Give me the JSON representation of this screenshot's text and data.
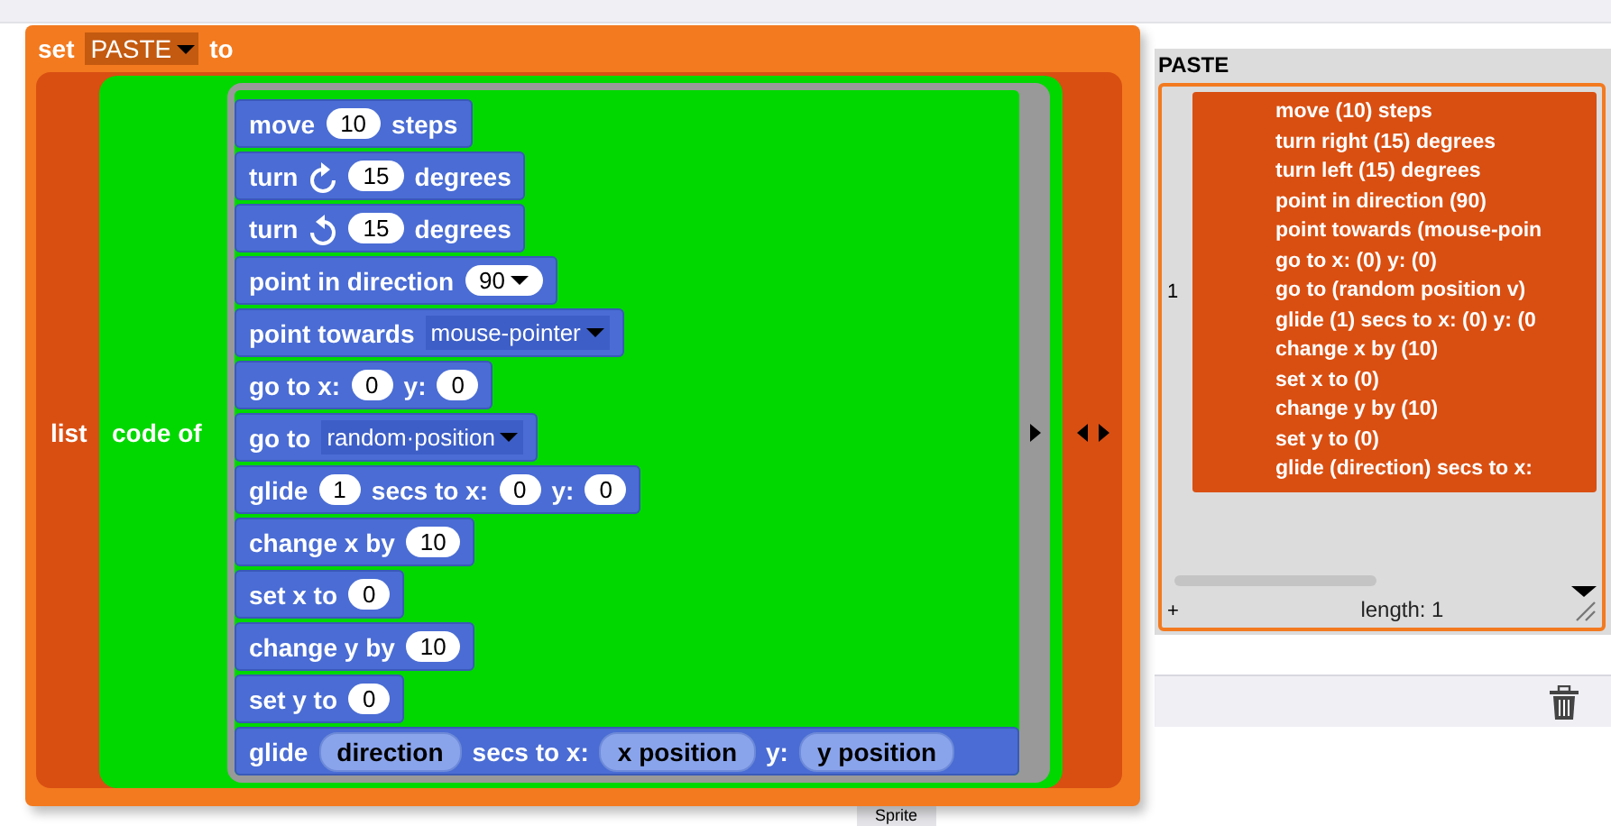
{
  "set_block": {
    "label": "set",
    "variable": "PASTE",
    "suffix": "to"
  },
  "list_block": {
    "label": "list"
  },
  "code_block": {
    "label": "code of"
  },
  "script": [
    {
      "parts": [
        {
          "kind": "text",
          "text": "move"
        },
        {
          "kind": "number",
          "text": "10"
        },
        {
          "kind": "text",
          "text": "steps"
        }
      ]
    },
    {
      "parts": [
        {
          "kind": "text",
          "text": "turn"
        },
        {
          "kind": "rotate_cw"
        },
        {
          "kind": "number",
          "text": "15"
        },
        {
          "kind": "text",
          "text": "degrees"
        }
      ]
    },
    {
      "parts": [
        {
          "kind": "text",
          "text": "turn"
        },
        {
          "kind": "rotate_ccw"
        },
        {
          "kind": "number",
          "text": "15"
        },
        {
          "kind": "text",
          "text": "degrees"
        }
      ]
    },
    {
      "parts": [
        {
          "kind": "text",
          "text": "point in direction"
        },
        {
          "kind": "number_menu",
          "text": "90"
        }
      ]
    },
    {
      "parts": [
        {
          "kind": "text",
          "text": "point towards"
        },
        {
          "kind": "menu",
          "text": "mouse-pointer"
        }
      ]
    },
    {
      "parts": [
        {
          "kind": "text",
          "text": "go to x:"
        },
        {
          "kind": "number",
          "text": "0"
        },
        {
          "kind": "text",
          "text": "y:"
        },
        {
          "kind": "number",
          "text": "0"
        }
      ]
    },
    {
      "parts": [
        {
          "kind": "text",
          "text": "go to"
        },
        {
          "kind": "menu",
          "text": "random·position"
        }
      ]
    },
    {
      "parts": [
        {
          "kind": "text",
          "text": "glide"
        },
        {
          "kind": "number",
          "text": "1"
        },
        {
          "kind": "text",
          "text": "secs to x:"
        },
        {
          "kind": "number",
          "text": "0"
        },
        {
          "kind": "text",
          "text": "y:"
        },
        {
          "kind": "number",
          "text": "0"
        }
      ]
    },
    {
      "parts": [
        {
          "kind": "text",
          "text": "change x by"
        },
        {
          "kind": "number",
          "text": "10"
        }
      ]
    },
    {
      "parts": [
        {
          "kind": "text",
          "text": "set x to"
        },
        {
          "kind": "number",
          "text": "0"
        }
      ]
    },
    {
      "parts": [
        {
          "kind": "text",
          "text": "change y by"
        },
        {
          "kind": "number",
          "text": "10"
        }
      ]
    },
    {
      "parts": [
        {
          "kind": "text",
          "text": "set y to"
        },
        {
          "kind": "number",
          "text": "0"
        }
      ]
    },
    {
      "parts": [
        {
          "kind": "text",
          "text": "glide"
        },
        {
          "kind": "reporter",
          "text": "direction"
        },
        {
          "kind": "text",
          "text": "secs to x:"
        },
        {
          "kind": "reporter",
          "text": "x position"
        },
        {
          "kind": "text",
          "text": "y:"
        },
        {
          "kind": "reporter",
          "text": "y position"
        }
      ]
    }
  ],
  "watcher": {
    "title": "PASTE",
    "index": "1",
    "lines": [
      "move (10) steps",
      "turn right (15) degrees",
      "turn left (15) degrees",
      "point in direction (90)",
      "point towards (mouse-poin",
      "go to x: (0) y: (0)",
      "go to (random position v)",
      "glide (1) secs to x: (0) y: (0",
      "change x by (10)",
      "set x to (0)",
      "change y by (10)",
      "set y to (0)",
      "glide (direction) secs to x:"
    ],
    "add": "+",
    "length": "length: 1"
  },
  "sprite_tab": "Sprite"
}
